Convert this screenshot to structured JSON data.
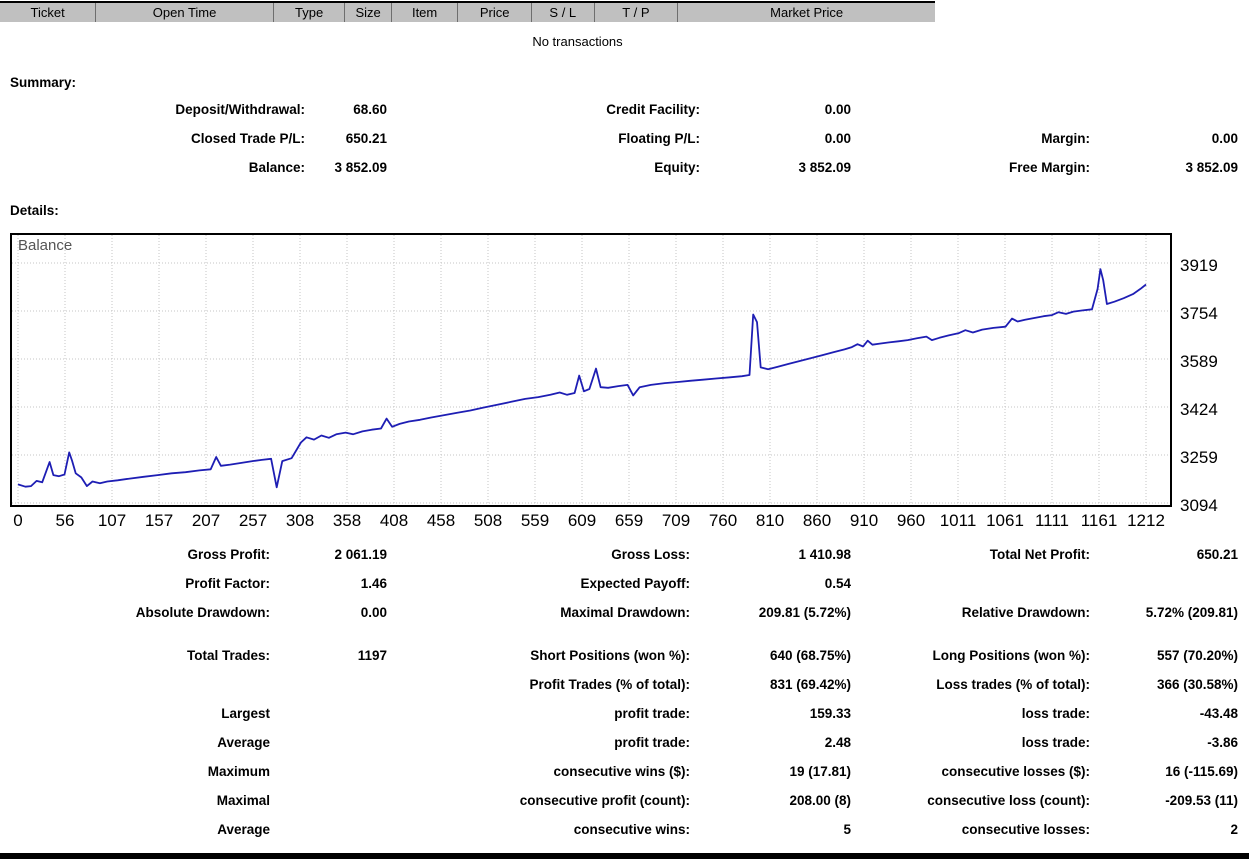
{
  "colors": {
    "header_bg": "#c0c0c0",
    "chart_line": "#1e1eb4"
  },
  "transactions_table": {
    "columns": [
      "Ticket",
      "Open Time",
      "Type",
      "Size",
      "Item",
      "Price",
      "S / L",
      "T / P",
      "Market Price"
    ],
    "empty_message": "No transactions"
  },
  "summary": {
    "heading": "Summary:",
    "rows": [
      [
        "Deposit/Withdrawal:",
        "68.60",
        "Credit Facility:",
        "0.00",
        "",
        ""
      ],
      [
        "Closed Trade P/L:",
        "650.21",
        "Floating P/L:",
        "0.00",
        "Margin:",
        "0.00"
      ],
      [
        "Balance:",
        "3 852.09",
        "Equity:",
        "3 852.09",
        "Free Margin:",
        "3 852.09"
      ]
    ]
  },
  "details": {
    "heading": "Details:"
  },
  "chart_data": {
    "type": "line",
    "title": "Balance",
    "xlabel": "",
    "ylabel": "",
    "xlim": [
      0,
      1212
    ],
    "ylim": [
      3094,
      3919
    ],
    "grid": "dotted",
    "legend": "none",
    "line_color": "#1e1eb4",
    "x_ticks": [
      0,
      56,
      107,
      157,
      207,
      257,
      308,
      358,
      408,
      458,
      508,
      559,
      609,
      659,
      709,
      760,
      810,
      860,
      910,
      960,
      1011,
      1061,
      1111,
      1161,
      1212
    ],
    "y_ticks": [
      3919,
      3754,
      3589,
      3424,
      3259,
      3094
    ],
    "series": [
      {
        "name": "Balance",
        "points": [
          [
            0,
            3158
          ],
          [
            8,
            3150
          ],
          [
            14,
            3152
          ],
          [
            20,
            3170
          ],
          [
            26,
            3165
          ],
          [
            30,
            3200
          ],
          [
            34,
            3235
          ],
          [
            38,
            3190
          ],
          [
            44,
            3186
          ],
          [
            50,
            3192
          ],
          [
            55,
            3268
          ],
          [
            58,
            3240
          ],
          [
            62,
            3196
          ],
          [
            68,
            3182
          ],
          [
            74,
            3152
          ],
          [
            80,
            3168
          ],
          [
            88,
            3162
          ],
          [
            96,
            3168
          ],
          [
            107,
            3172
          ],
          [
            120,
            3178
          ],
          [
            135,
            3184
          ],
          [
            150,
            3190
          ],
          [
            165,
            3196
          ],
          [
            180,
            3200
          ],
          [
            195,
            3206
          ],
          [
            207,
            3210
          ],
          [
            213,
            3252
          ],
          [
            218,
            3222
          ],
          [
            228,
            3226
          ],
          [
            240,
            3232
          ],
          [
            252,
            3238
          ],
          [
            262,
            3242
          ],
          [
            272,
            3246
          ],
          [
            278,
            3148
          ],
          [
            284,
            3238
          ],
          [
            294,
            3248
          ],
          [
            304,
            3302
          ],
          [
            310,
            3320
          ],
          [
            318,
            3312
          ],
          [
            326,
            3326
          ],
          [
            334,
            3318
          ],
          [
            342,
            3330
          ],
          [
            352,
            3336
          ],
          [
            360,
            3330
          ],
          [
            370,
            3340
          ],
          [
            380,
            3346
          ],
          [
            390,
            3350
          ],
          [
            396,
            3384
          ],
          [
            402,
            3356
          ],
          [
            410,
            3366
          ],
          [
            420,
            3374
          ],
          [
            432,
            3380
          ],
          [
            444,
            3388
          ],
          [
            458,
            3396
          ],
          [
            472,
            3404
          ],
          [
            486,
            3412
          ],
          [
            500,
            3422
          ],
          [
            515,
            3432
          ],
          [
            530,
            3442
          ],
          [
            545,
            3452
          ],
          [
            559,
            3458
          ],
          [
            572,
            3466
          ],
          [
            582,
            3474
          ],
          [
            590,
            3466
          ],
          [
            598,
            3472
          ],
          [
            603,
            3532
          ],
          [
            608,
            3478
          ],
          [
            614,
            3486
          ],
          [
            621,
            3556
          ],
          [
            626,
            3492
          ],
          [
            634,
            3490
          ],
          [
            645,
            3496
          ],
          [
            655,
            3500
          ],
          [
            661,
            3464
          ],
          [
            668,
            3492
          ],
          [
            680,
            3500
          ],
          [
            695,
            3506
          ],
          [
            709,
            3510
          ],
          [
            722,
            3514
          ],
          [
            736,
            3518
          ],
          [
            750,
            3522
          ],
          [
            765,
            3526
          ],
          [
            778,
            3530
          ],
          [
            786,
            3534
          ],
          [
            790,
            3742
          ],
          [
            794,
            3716
          ],
          [
            798,
            3560
          ],
          [
            806,
            3554
          ],
          [
            816,
            3562
          ],
          [
            828,
            3572
          ],
          [
            840,
            3582
          ],
          [
            852,
            3592
          ],
          [
            864,
            3602
          ],
          [
            876,
            3612
          ],
          [
            888,
            3622
          ],
          [
            896,
            3630
          ],
          [
            902,
            3640
          ],
          [
            908,
            3632
          ],
          [
            913,
            3652
          ],
          [
            918,
            3638
          ],
          [
            926,
            3642
          ],
          [
            936,
            3646
          ],
          [
            946,
            3650
          ],
          [
            956,
            3654
          ],
          [
            966,
            3660
          ],
          [
            976,
            3666
          ],
          [
            982,
            3654
          ],
          [
            990,
            3662
          ],
          [
            1000,
            3670
          ],
          [
            1011,
            3678
          ],
          [
            1018,
            3688
          ],
          [
            1026,
            3680
          ],
          [
            1036,
            3690
          ],
          [
            1048,
            3696
          ],
          [
            1061,
            3700
          ],
          [
            1068,
            3728
          ],
          [
            1074,
            3718
          ],
          [
            1082,
            3724
          ],
          [
            1092,
            3730
          ],
          [
            1102,
            3736
          ],
          [
            1111,
            3740
          ],
          [
            1118,
            3750
          ],
          [
            1126,
            3744
          ],
          [
            1134,
            3752
          ],
          [
            1144,
            3756
          ],
          [
            1154,
            3760
          ],
          [
            1160,
            3830
          ],
          [
            1163,
            3898
          ],
          [
            1166,
            3860
          ],
          [
            1170,
            3778
          ],
          [
            1178,
            3786
          ],
          [
            1188,
            3798
          ],
          [
            1198,
            3812
          ],
          [
            1206,
            3830
          ],
          [
            1212,
            3845
          ]
        ]
      }
    ]
  },
  "stats": {
    "rows": [
      [
        "Gross Profit:",
        "2 061.19",
        "Gross Loss:",
        "1 410.98",
        "Total Net Profit:",
        "650.21"
      ],
      [
        "Profit Factor:",
        "1.46",
        "Expected Payoff:",
        "0.54",
        "",
        ""
      ],
      [
        "Absolute Drawdown:",
        "0.00",
        "Maximal Drawdown:",
        "209.81 (5.72%)",
        "Relative Drawdown:",
        "5.72% (209.81)"
      ],
      [
        "Total Trades:",
        "1197",
        "Short Positions (won %):",
        "640 (68.75%)",
        "Long Positions (won %):",
        "557 (70.20%)"
      ],
      [
        "",
        "",
        "Profit Trades (% of total):",
        "831 (69.42%)",
        "Loss trades (% of total):",
        "366 (30.58%)"
      ],
      [
        "Largest",
        "",
        "profit trade:",
        "159.33",
        "loss trade:",
        "-43.48"
      ],
      [
        "Average",
        "",
        "profit trade:",
        "2.48",
        "loss trade:",
        "-3.86"
      ],
      [
        "Maximum",
        "",
        "consecutive wins ($):",
        "19 (17.81)",
        "consecutive losses ($):",
        "16 (-115.69)"
      ],
      [
        "Maximal",
        "",
        "consecutive profit (count):",
        "208.00 (8)",
        "consecutive loss (count):",
        "-209.53 (11)"
      ],
      [
        "Average",
        "",
        "consecutive wins:",
        "5",
        "consecutive losses:",
        "2"
      ]
    ]
  }
}
